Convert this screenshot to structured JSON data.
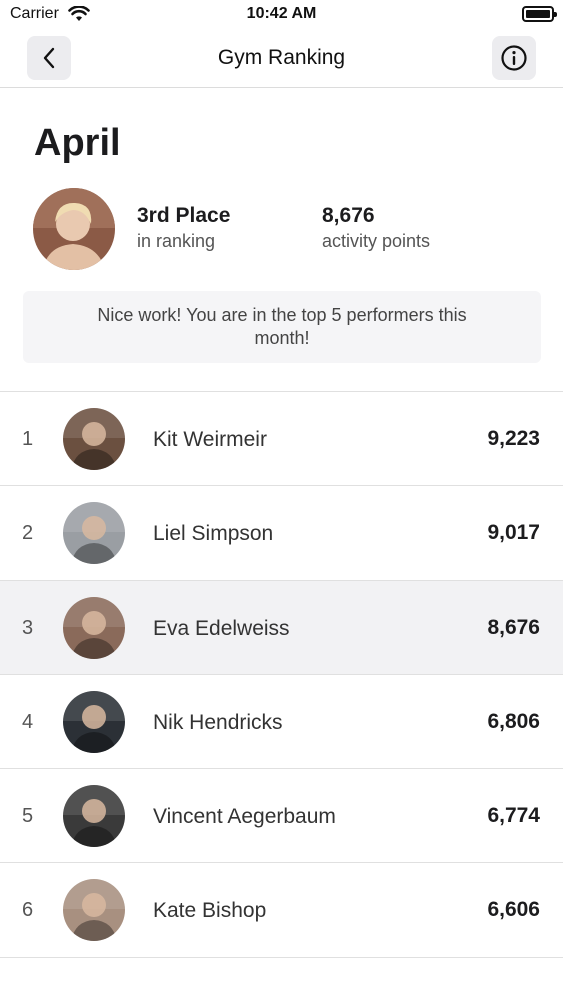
{
  "status_bar": {
    "carrier": "Carrier",
    "time": "10:42 AM"
  },
  "nav": {
    "title": "Gym Ranking",
    "back_icon": "chevron-left-icon",
    "info_icon": "info-circle-icon"
  },
  "header": {
    "month": "April",
    "place_value": "3rd Place",
    "place_label": "in ranking",
    "points_value": "8,676",
    "points_label": "activity points",
    "banner": "Nice work! You are in the top 5 performers this month!"
  },
  "ranking": [
    {
      "rank": "1",
      "name": "Kit Weirmeir",
      "points": "9,223",
      "avatar_color": "#6b5040"
    },
    {
      "rank": "2",
      "name": "Liel Simpson",
      "points": "9,017",
      "avatar_color": "#9a9ea3"
    },
    {
      "rank": "3",
      "name": "Eva Edelweiss",
      "points": "8,676",
      "avatar_color": "#8a6a5a",
      "highlight": true
    },
    {
      "rank": "4",
      "name": "Nik Hendricks",
      "points": "6,806",
      "avatar_color": "#2b3036"
    },
    {
      "rank": "5",
      "name": "Vincent Aegerbaum",
      "points": "6,774",
      "avatar_color": "#3a3a3a"
    },
    {
      "rank": "6",
      "name": "Kate Bishop",
      "points": "6,606",
      "avatar_color": "#a89080"
    }
  ]
}
